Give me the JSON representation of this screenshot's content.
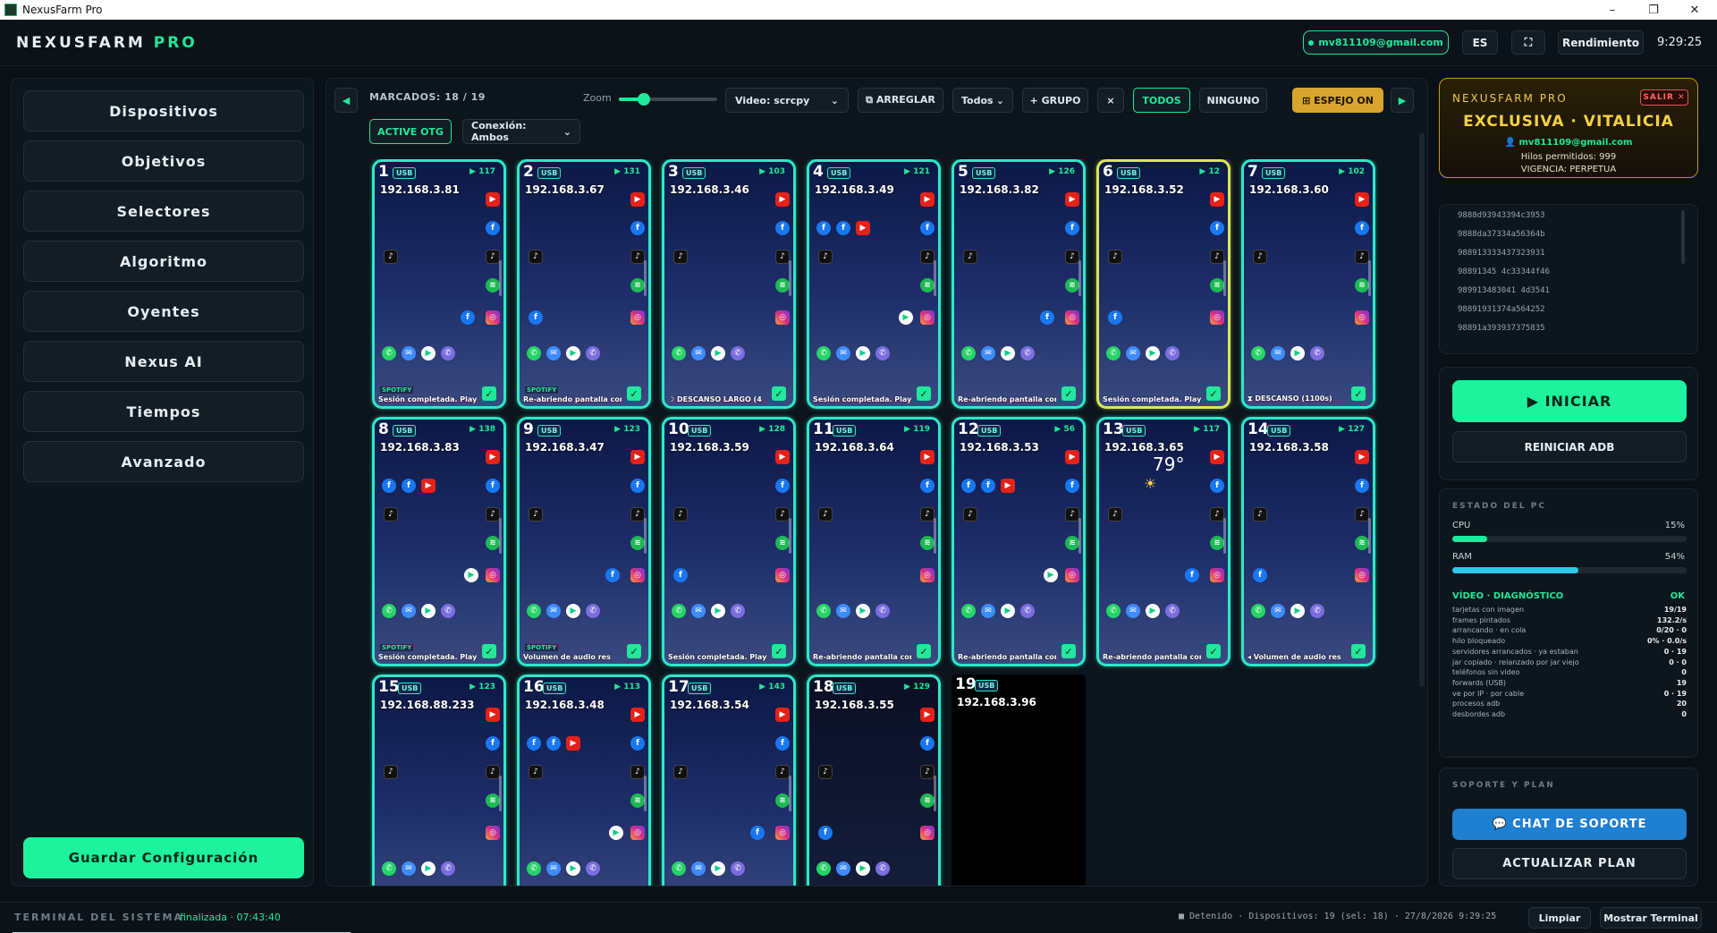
{
  "window": {
    "title": "NexusFarm Pro",
    "controls": [
      "–",
      "❐",
      "✕"
    ]
  },
  "header": {
    "logo_main": "NEXUSFARM",
    "logo_accent": "PRO",
    "email": "mv811109@gmail.com",
    "lang": "ES",
    "fullscreen_icon": "⛶",
    "rendimiento": "Rendimiento",
    "clock": "9:29:25"
  },
  "sidebar": {
    "items": [
      {
        "label": "Dispositivos"
      },
      {
        "label": "Objetivos"
      },
      {
        "label": "Selectores"
      },
      {
        "label": "Algoritmo"
      },
      {
        "label": "Oyentes"
      },
      {
        "label": "Nexus AI"
      },
      {
        "label": "Tiempos"
      },
      {
        "label": "Avanzado"
      }
    ],
    "save_label": "Guardar Configuración"
  },
  "toolbar": {
    "marcados": "MARCADOS: 18 / 19",
    "zoom_label": "Zoom",
    "zoom_level": 0.25,
    "video_select": "Video: scrcpy",
    "arreglar": "⧉ ARREGLAR",
    "filter_select": "Todos",
    "grupo": "+ GRUPO",
    "clear": "×",
    "todos": "TODOS",
    "ninguno": "NINGUNO",
    "espejo": "⊞ ESPEJO ON",
    "active_otg": "ACTIVE OTG",
    "conexion_select": "Conexión: Ambos"
  },
  "devices": [
    {
      "num": "1",
      "tag": "USB",
      "battery": "▶ 117",
      "ip": "192.168.3.81",
      "status": "Sesión completada. Playlist",
      "spotify": "SPOTIFY",
      "checked": true
    },
    {
      "num": "2",
      "tag": "USB",
      "battery": "▶ 131",
      "ip": "192.168.3.67",
      "status": "Re-abriendo pantalla com",
      "spotify": "SPOTIFY",
      "checked": true
    },
    {
      "num": "3",
      "tag": "USB",
      "battery": "▶ 103",
      "ip": "192.168.3.46",
      "status": "☽ DESCANSO LARGO (4",
      "spotify": "",
      "checked": true
    },
    {
      "num": "4",
      "tag": "USB",
      "battery": "▶ 121",
      "ip": "192.168.3.49",
      "status": "Sesión completada. Playl",
      "spotify": "",
      "checked": true
    },
    {
      "num": "5",
      "tag": "USB",
      "battery": "▶ 126",
      "ip": "192.168.3.82",
      "status": "Re-abriendo pantalla com",
      "spotify": "",
      "checked": true
    },
    {
      "num": "6",
      "tag": "USB",
      "battery": "▶ 12",
      "ip": "192.168.3.52",
      "status": "Sesión completada. Playl",
      "spotify": "",
      "checked": true,
      "highlight": "yellow"
    },
    {
      "num": "7",
      "tag": "USB",
      "battery": "▶ 102",
      "ip": "192.168.3.60",
      "status": "⧗ DESCANSO (1100s)",
      "spotify": "",
      "checked": true
    },
    {
      "num": "8",
      "tag": "USB",
      "battery": "▶ 138",
      "ip": "192.168.3.83",
      "status": "Sesión completada. Playl",
      "spotify": "SPOTIFY",
      "checked": true
    },
    {
      "num": "9",
      "tag": "USB",
      "battery": "▶ 123",
      "ip": "192.168.3.47",
      "status": "Volumen de audio res",
      "spotify": "SPOTIFY",
      "checked": true
    },
    {
      "num": "10",
      "tag": "USB",
      "battery": "▶ 128",
      "ip": "192.168.3.59",
      "status": "Sesión completada. Playl",
      "spotify": "",
      "checked": true
    },
    {
      "num": "11",
      "tag": "USB",
      "battery": "▶ 119",
      "ip": "192.168.3.64",
      "status": "Re-abriendo pantalla com",
      "spotify": "",
      "checked": true
    },
    {
      "num": "12",
      "tag": "USB",
      "battery": "▶ 56",
      "ip": "192.168.3.53",
      "status": "Re-abriendo pantalla com",
      "spotify": "",
      "checked": true
    },
    {
      "num": "13",
      "tag": "USB",
      "battery": "▶ 117",
      "ip": "192.168.3.65",
      "status": "Re-abriendo pantalla com",
      "spotify": "",
      "checked": true,
      "weather": "79°"
    },
    {
      "num": "14",
      "tag": "USB",
      "battery": "▶ 127",
      "ip": "192.168.3.58",
      "status": "◂ Volumen de audio res",
      "spotify": "",
      "checked": true
    },
    {
      "num": "15",
      "tag": "USB",
      "battery": "▶ 123",
      "ip": "192.168.88.233",
      "status": "",
      "spotify": "",
      "checked": false
    },
    {
      "num": "16",
      "tag": "USB",
      "battery": "▶ 113",
      "ip": "192.168.3.48",
      "status": "",
      "spotify": "",
      "checked": false
    },
    {
      "num": "17",
      "tag": "USB",
      "battery": "▶ 143",
      "ip": "192.168.3.54",
      "status": "",
      "spotify": "",
      "checked": false
    },
    {
      "num": "18",
      "tag": "USB",
      "battery": "▶ 129",
      "ip": "192.168.3.55",
      "status": "",
      "spotify": "",
      "checked": false,
      "variant": "gray"
    },
    {
      "num": "19",
      "tag": "USB",
      "battery": "",
      "ip": "192.168.3.96",
      "status": "",
      "spotify": "",
      "checked": false,
      "variant": "dark"
    }
  ],
  "license": {
    "brand": "NEXUSFARM PRO",
    "logout": "SALIR ✕",
    "title": "EXCLUSIVA · VITALICIA",
    "email": "mv811109@gmail.com",
    "threads": "Hilos permitidos: 999",
    "vigencia": "VIGENCIA: PERPETUA"
  },
  "serials": [
    "9888d93943394c3953",
    "9888da37334a56364b",
    "988913333437323931",
    "98891345 4c33344f46",
    "989913483041 4d3541",
    "98891931374a564252",
    "98891a393937375835"
  ],
  "actions": {
    "start": "▶ INICIAR",
    "restart_adb": "REINICIAR ADB"
  },
  "pc_status": {
    "title": "ESTADO DEL PC",
    "cpu_label": "CPU",
    "cpu_value": "15%",
    "cpu": 0.15,
    "ram_label": "RAM",
    "ram_value": "54%",
    "ram": 0.54,
    "diag_title": "VÍDEO · DIAGNÓSTICO",
    "diag_status": "OK",
    "diag_rows": [
      {
        "label": "tarjetas con imagen",
        "value": "19/19"
      },
      {
        "label": "frames pintados",
        "value": "132.2/s"
      },
      {
        "label": "arrancando · en cola",
        "value": "0/20 · 0"
      },
      {
        "label": "hilo bloqueado",
        "value": "0% · 0.0/s"
      },
      {
        "label": "servidores arrancados · ya estaban",
        "value": "0 · 19"
      },
      {
        "label": "jar copiado · relanzado por jar viejo",
        "value": "0 · 0"
      },
      {
        "label": "teléfonos sin video",
        "value": "0"
      },
      {
        "label": "forwards (USB)",
        "value": "19"
      },
      {
        "label": "ve por IP · por cable",
        "value": "0 · 19"
      },
      {
        "label": "procesos adb",
        "value": "20"
      },
      {
        "label": "desbordes adb",
        "value": "0"
      }
    ]
  },
  "support": {
    "title": "SOPORTE Y PLAN",
    "chat": "💬 CHAT DE SOPORTE",
    "plan": "ACTUALIZAR PLAN"
  },
  "footer": {
    "terminal_label": "TERMINAL DEL SISTEMA",
    "terminal_status": "finalizada · 07:43:40",
    "status_line": "■ Detenido · Dispositivos: 19 (sel: 18) · 27/8/2026 9:29:25",
    "clear": "Limpiar",
    "show_terminal": "Mostrar Terminal"
  },
  "colors": {
    "accent": "#1ef29c",
    "card_border": "#2ee8c8",
    "gold": "#d9a52e",
    "blue": "#1f7fd0"
  }
}
